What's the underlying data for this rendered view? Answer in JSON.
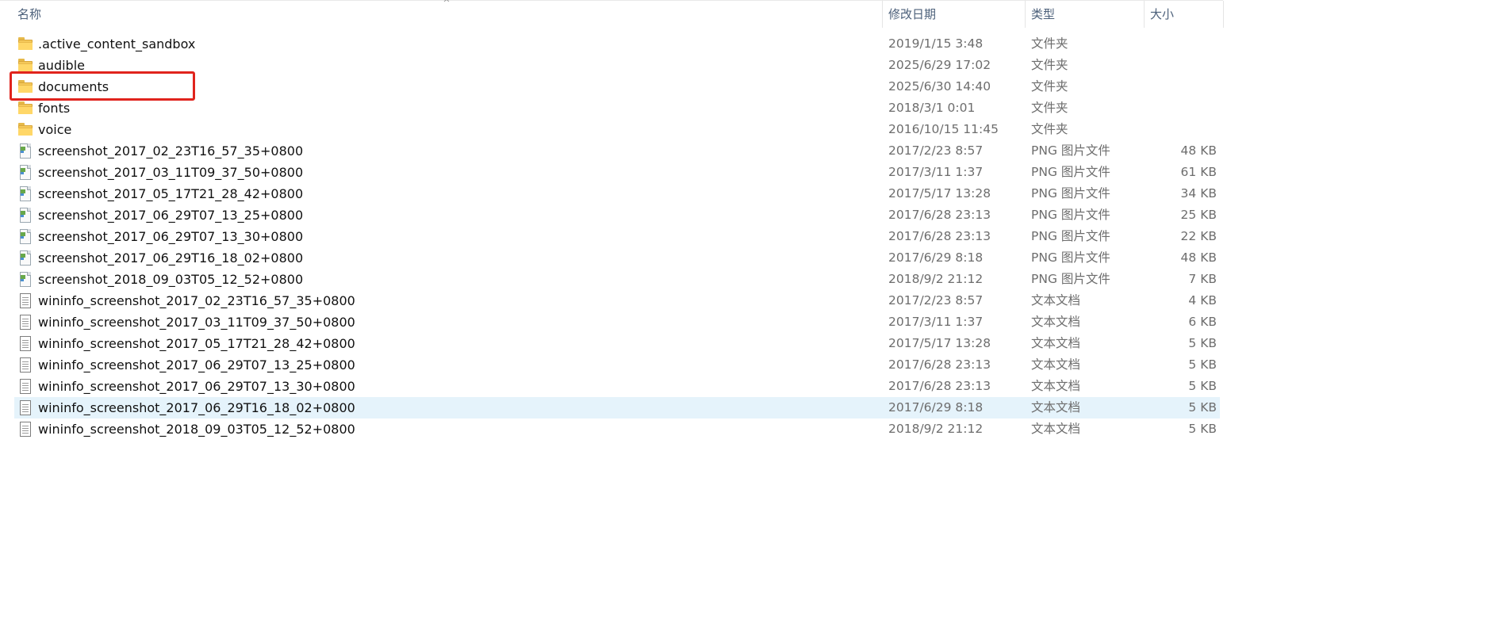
{
  "columns": {
    "name": "名称",
    "modified": "修改日期",
    "type": "类型",
    "size": "大小"
  },
  "sort_indicator": "^",
  "files": [
    {
      "name": ".active_content_sandbox",
      "modified": "2019/1/15 3:48",
      "type": "文件夹",
      "size": "",
      "icon": "folder-icon"
    },
    {
      "name": "audible",
      "modified": "2025/6/29 17:02",
      "type": "文件夹",
      "size": "",
      "icon": "folder-icon"
    },
    {
      "name": "documents",
      "modified": "2025/6/30 14:40",
      "type": "文件夹",
      "size": "",
      "icon": "folder-icon",
      "highlighted": true
    },
    {
      "name": "fonts",
      "modified": "2018/3/1 0:01",
      "type": "文件夹",
      "size": "",
      "icon": "folder-icon"
    },
    {
      "name": "voice",
      "modified": "2016/10/15 11:45",
      "type": "文件夹",
      "size": "",
      "icon": "folder-icon"
    },
    {
      "name": "screenshot_2017_02_23T16_57_35+0800",
      "modified": "2017/2/23 8:57",
      "type": "PNG 图片文件",
      "size": "48 KB",
      "icon": "png-file-icon"
    },
    {
      "name": "screenshot_2017_03_11T09_37_50+0800",
      "modified": "2017/3/11 1:37",
      "type": "PNG 图片文件",
      "size": "61 KB",
      "icon": "png-file-icon"
    },
    {
      "name": "screenshot_2017_05_17T21_28_42+0800",
      "modified": "2017/5/17 13:28",
      "type": "PNG 图片文件",
      "size": "34 KB",
      "icon": "png-file-icon"
    },
    {
      "name": "screenshot_2017_06_29T07_13_25+0800",
      "modified": "2017/6/28 23:13",
      "type": "PNG 图片文件",
      "size": "25 KB",
      "icon": "png-file-icon"
    },
    {
      "name": "screenshot_2017_06_29T07_13_30+0800",
      "modified": "2017/6/28 23:13",
      "type": "PNG 图片文件",
      "size": "22 KB",
      "icon": "png-file-icon"
    },
    {
      "name": "screenshot_2017_06_29T16_18_02+0800",
      "modified": "2017/6/29 8:18",
      "type": "PNG 图片文件",
      "size": "48 KB",
      "icon": "png-file-icon"
    },
    {
      "name": "screenshot_2018_09_03T05_12_52+0800",
      "modified": "2018/9/2 21:12",
      "type": "PNG 图片文件",
      "size": "7 KB",
      "icon": "png-file-icon"
    },
    {
      "name": "wininfo_screenshot_2017_02_23T16_57_35+0800",
      "modified": "2017/2/23 8:57",
      "type": "文本文档",
      "size": "4 KB",
      "icon": "text-file-icon"
    },
    {
      "name": "wininfo_screenshot_2017_03_11T09_37_50+0800",
      "modified": "2017/3/11 1:37",
      "type": "文本文档",
      "size": "6 KB",
      "icon": "text-file-icon"
    },
    {
      "name": "wininfo_screenshot_2017_05_17T21_28_42+0800",
      "modified": "2017/5/17 13:28",
      "type": "文本文档",
      "size": "5 KB",
      "icon": "text-file-icon"
    },
    {
      "name": "wininfo_screenshot_2017_06_29T07_13_25+0800",
      "modified": "2017/6/28 23:13",
      "type": "文本文档",
      "size": "5 KB",
      "icon": "text-file-icon"
    },
    {
      "name": "wininfo_screenshot_2017_06_29T07_13_30+0800",
      "modified": "2017/6/28 23:13",
      "type": "文本文档",
      "size": "5 KB",
      "icon": "text-file-icon"
    },
    {
      "name": "wininfo_screenshot_2017_06_29T16_18_02+0800",
      "modified": "2017/6/29 8:18",
      "type": "文本文档",
      "size": "5 KB",
      "icon": "text-file-icon",
      "selected": true
    },
    {
      "name": "wininfo_screenshot_2018_09_03T05_12_52+0800",
      "modified": "2018/9/2 21:12",
      "type": "文本文档",
      "size": "5 KB",
      "icon": "text-file-icon"
    }
  ],
  "colors": {
    "highlight_box": "#e0241d",
    "selected_row": "#e5f3fb",
    "header_text": "#4c607a"
  }
}
